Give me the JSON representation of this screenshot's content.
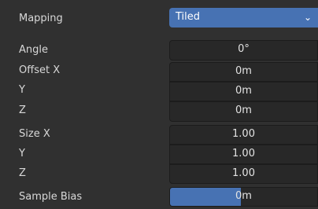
{
  "mapping": {
    "label": "Mapping",
    "value": "Tiled",
    "chevron_icon": "chevron-down-icon"
  },
  "angle": {
    "label": "Angle",
    "value": "0°"
  },
  "offset": {
    "x_label": "Offset X",
    "x_value": "0m",
    "y_label": "Y",
    "y_value": "0m",
    "z_label": "Z",
    "z_value": "0m"
  },
  "size": {
    "x_label": "Size X",
    "x_value": "1.00",
    "y_label": "Y",
    "y_value": "1.00",
    "z_label": "Z",
    "z_value": "1.00"
  },
  "sample_bias": {
    "label": "Sample Bias",
    "value": "0m",
    "slider_fraction": 0.48
  },
  "colors": {
    "accent": "#4772b3",
    "field_bg": "#282828",
    "panel_bg": "#303030"
  }
}
